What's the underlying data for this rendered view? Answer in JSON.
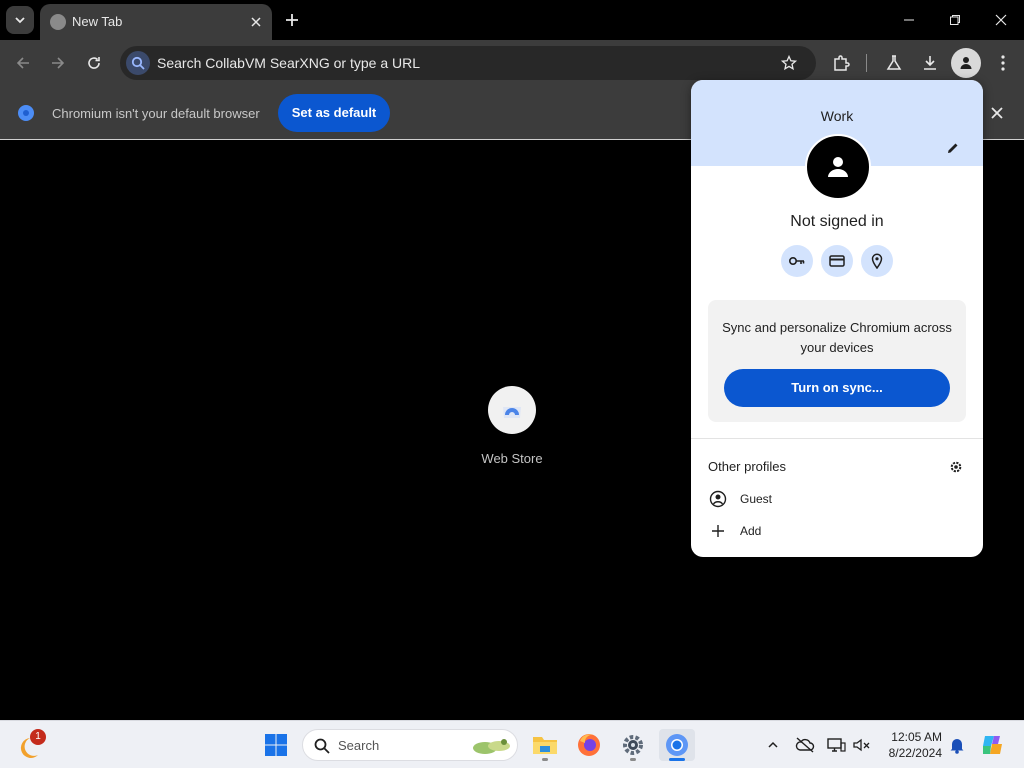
{
  "tab": {
    "title": "New Tab"
  },
  "omnibox": {
    "placeholder": "Search CollabVM SearXNG or type a URL"
  },
  "infobar": {
    "message": "Chromium isn't your default browser",
    "button_label": "Set as default"
  },
  "content": {
    "shortcut_label": "Web Store"
  },
  "profile_popup": {
    "profile_name": "Work",
    "status": "Not signed in",
    "sync_text": "Sync and personalize Chromium across your devices",
    "sync_button": "Turn on sync...",
    "other_profiles_heading": "Other profiles",
    "other_profiles": [
      {
        "label": "Guest",
        "icon": "guest-icon"
      },
      {
        "label": "Add",
        "icon": "plus-icon"
      }
    ],
    "quick_actions": [
      "passwords-key-icon",
      "payment-card-icon",
      "addresses-pin-icon"
    ]
  },
  "taskbar": {
    "widgets_badge": "1",
    "search_label": "Search",
    "clock_time": "12:05 AM",
    "clock_date": "8/22/2024",
    "pinned": [
      "start-icon",
      "file-explorer-icon",
      "firefox-icon",
      "settings-icon",
      "chromium-icon"
    ]
  },
  "colors": {
    "accent": "#0b57d0",
    "popup_header": "#d3e3fd",
    "toolbar": "#3c3c3c"
  }
}
